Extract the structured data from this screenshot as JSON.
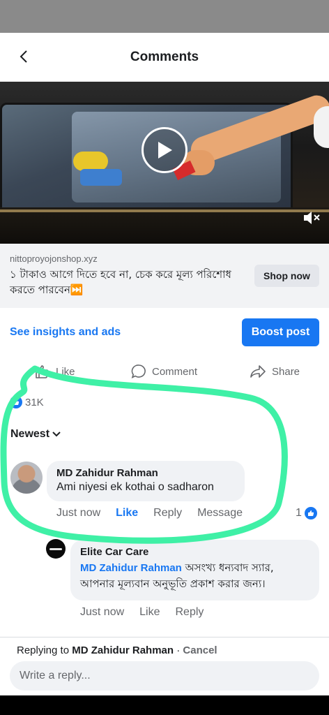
{
  "header": {
    "title": "Comments"
  },
  "ad": {
    "domain": "nittoproyojonshop.xyz",
    "text": "১ টাকাও আগে দিতে হবে না, চেক করে মূল্য পরিশোধ করতে পারবেন⏭️",
    "shop_button": "Shop now"
  },
  "post": {
    "insights_link": "See insights and ads",
    "boost_button": "Boost post",
    "actions": {
      "like": "Like",
      "comment": "Comment",
      "share": "Share"
    },
    "reaction_count": "31K"
  },
  "sort": {
    "label": "Newest"
  },
  "comments": [
    {
      "author": "MD Zahidur Rahman",
      "text": "Ami niyesi ek kothai o sadharon",
      "time": "Just now",
      "like": "Like",
      "reply": "Reply",
      "message": "Message",
      "reaction_count": "1"
    },
    {
      "author": "Elite Car Care",
      "mention": "MD Zahidur Rahman",
      "text": " অসংখ্য ধন্যবাদ স্যার, আপনার মূল্যবান অনুভূতি প্রকাশ করার জন্য।",
      "time": "Just now",
      "like": "Like",
      "reply": "Reply"
    }
  ],
  "reply_bar": {
    "replying_prefix": "Replying to ",
    "replying_name": "MD Zahidur Rahman",
    "separator": " · ",
    "cancel": "Cancel",
    "placeholder": "Write a reply..."
  },
  "colors": {
    "accent": "#1877f2",
    "highlight": "#3ff0a6"
  },
  "icons": [
    "back-arrow-icon",
    "play-icon",
    "mute-icon",
    "thumbs-up-icon",
    "comment-icon",
    "share-icon",
    "like-reaction-icon",
    "chevron-down-icon"
  ]
}
